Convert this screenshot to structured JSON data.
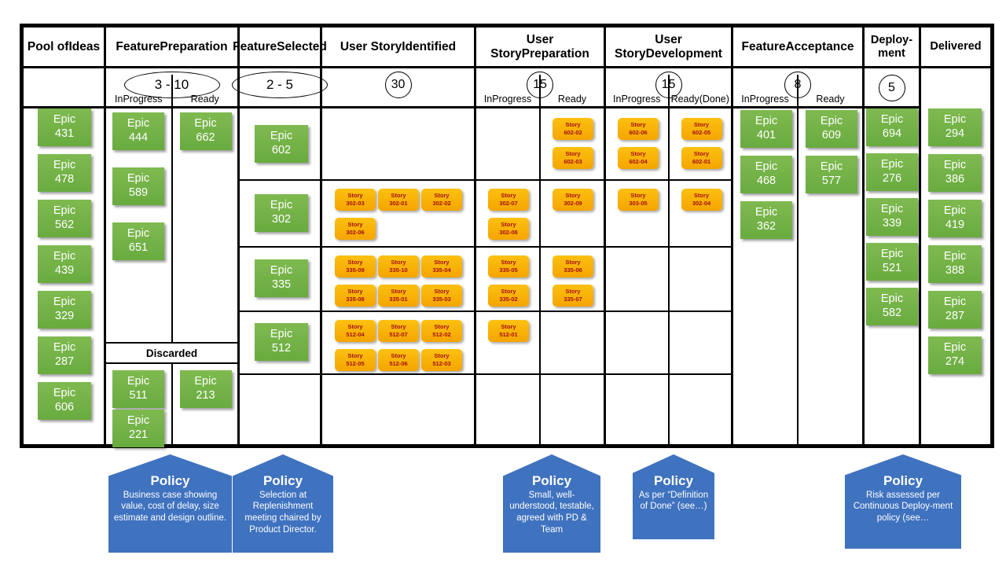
{
  "board": {
    "columns": [
      {
        "id": "pool-of-ideas",
        "title": "Pool of\nIdeas",
        "wip": null,
        "subcolumns": [],
        "cards": [
          "Epic\n431",
          "Epic\n478",
          "Epic\n562",
          "Epic\n439",
          "Epic\n329",
          "Epic\n287",
          "Epic\n606"
        ]
      },
      {
        "id": "feature-preparation",
        "title": "Feature\nPreparation",
        "wip": "3 - 10",
        "wip_shape": "ellipse-wide",
        "subcolumns": [
          "In\nProgress",
          "Ready"
        ],
        "discarded_label": "Discarded",
        "in_progress": [
          "Epic\n444",
          "Epic\n589",
          "Epic\n651"
        ],
        "ready": [
          "Epic\n662"
        ],
        "discarded_in_progress": [
          "Epic\n511",
          "Epic\n221"
        ],
        "discarded_ready": [
          "Epic\n213"
        ]
      },
      {
        "id": "feature-selected",
        "title": "Feature\nSelected",
        "wip": "2 - 5",
        "wip_shape": "ellipse-wide",
        "subcolumns": [],
        "rows": [
          "Epic\n602",
          "Epic\n302",
          "Epic\n335",
          "Epic\n512",
          ""
        ]
      },
      {
        "id": "user-story-identified",
        "title": "User Story\nIdentified",
        "wip": "30",
        "wip_shape": "circle",
        "subcolumns": [],
        "rows": [
          [],
          [
            "Story\n302-03",
            "Story\n302-01",
            "Story\n302-02",
            "Story\n302-06"
          ],
          [
            "Story\n335-09",
            "Story\n335-10",
            "Story\n335-04",
            "Story\n335-08",
            "Story\n335-01",
            "Story\n335-03"
          ],
          [
            "Story\n512-04",
            "Story\n512-07",
            "Story\n512-02",
            "Story\n512-05",
            "Story\n512-06",
            "Story\n512-03"
          ],
          []
        ]
      },
      {
        "id": "user-story-preparation",
        "title": "User Story\nPreparation",
        "wip": "15",
        "wip_shape": "circle",
        "subcolumns": [
          "In\nProgress",
          "Ready"
        ],
        "in_progress_rows": [
          [],
          [
            "Story\n302-07",
            "Story\n302-08"
          ],
          [
            "Story\n335-05",
            "Story\n335-02"
          ],
          [
            "Story\n512-01"
          ],
          []
        ],
        "ready_rows": [
          [
            "Story\n602-02",
            "Story\n602-03"
          ],
          [
            "Story\n302-09"
          ],
          [
            "Story\n335-06",
            "Story\n335-07"
          ],
          [],
          []
        ]
      },
      {
        "id": "user-story-development",
        "title": "User Story\nDevelopment",
        "wip": "15",
        "wip_shape": "circle",
        "subcolumns": [
          "In\nProgress",
          "Ready\n(Done)"
        ],
        "in_progress_rows": [
          [
            "Story\n602-06",
            "Story\n602-04"
          ],
          [
            "Story\n303-05"
          ],
          [],
          [],
          []
        ],
        "ready_rows": [
          [
            "Story\n602-05",
            "Story\n602-01"
          ],
          [
            "Story\n302-04"
          ],
          [],
          [],
          []
        ]
      },
      {
        "id": "feature-acceptance",
        "title": "Feature\nAcceptance",
        "wip": "8",
        "wip_shape": "circle",
        "subcolumns": [
          "In\nProgress",
          "Ready"
        ],
        "in_progress": [
          "Epic\n401",
          "Epic\n468",
          "Epic\n362"
        ],
        "ready": [
          "Epic\n609",
          "Epic\n577"
        ]
      },
      {
        "id": "deployment",
        "title": "Deploy-\nment",
        "wip": "5",
        "wip_shape": "circle",
        "subcolumns": [],
        "cards": [
          "Epic\n694",
          "Epic\n276",
          "Epic\n339",
          "Epic\n521",
          "Epic\n582"
        ]
      },
      {
        "id": "delivered",
        "title": "Delivered",
        "wip": null,
        "subcolumns": [],
        "cards": [
          "Epic\n294",
          "Epic\n386",
          "Epic\n419",
          "Epic\n388",
          "Epic\n287",
          "Epic\n274"
        ]
      }
    ]
  },
  "policies": [
    {
      "id": "policy-feature-preparation",
      "title": "Policy",
      "body": "Business  case showing value, cost of delay, size estimate and design outline."
    },
    {
      "id": "policy-feature-selected",
      "title": "Policy",
      "body": "Selection at Replenishment meeting chaired by Product Director."
    },
    {
      "id": "policy-user-story-preparation",
      "title": "Policy",
      "body": "Small, well-understood, testable, agreed with PD & Team"
    },
    {
      "id": "policy-user-story-development",
      "title": "Policy",
      "body": "As per “Definition of Done” (see…)"
    },
    {
      "id": "policy-deployment",
      "title": "Policy",
      "body": "Risk assessed per Continuous  Deploy-ment policy (see…"
    }
  ],
  "colors": {
    "epic_card": "#70ad47",
    "story_card": "#f9b417",
    "story_text": "#a50f0f",
    "policy": "#3f72bf",
    "board_border": "#000000"
  }
}
